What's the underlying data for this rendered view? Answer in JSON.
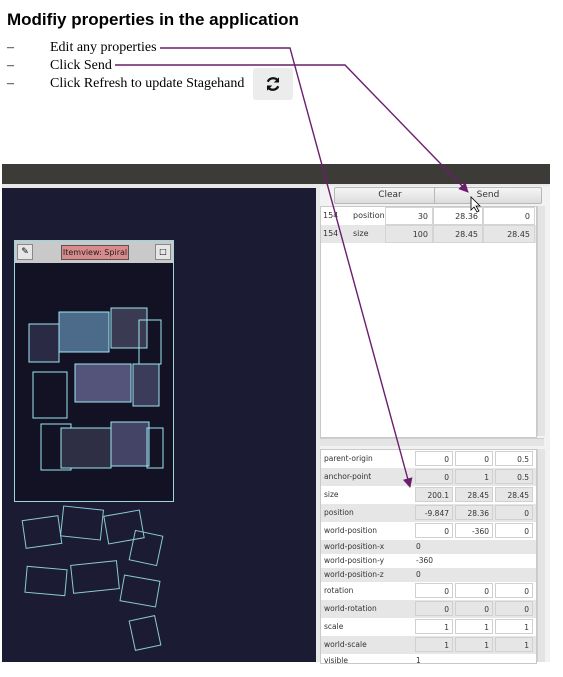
{
  "doc": {
    "title": "Modifiy properties in the application",
    "bullets": [
      {
        "dash": "–",
        "text": "Edit any properties"
      },
      {
        "dash": "–",
        "text": "Click Send"
      },
      {
        "dash": "–",
        "text": "Click Refresh to update Stagehand"
      }
    ],
    "refresh_icon": "refresh-icon"
  },
  "app": {
    "inner_window_title": "Itemview: Spiral",
    "buttons": {
      "clear": "Clear",
      "send": "Send"
    },
    "pending": [
      {
        "id": "154",
        "name": "position",
        "values": [
          "30",
          "28.36",
          "0"
        ]
      },
      {
        "id": "154",
        "name": "size",
        "values": [
          "100",
          "28.45",
          "28.45"
        ]
      }
    ],
    "properties": [
      {
        "name": "parent-origin",
        "values": [
          "0",
          "0",
          "0.5"
        ]
      },
      {
        "name": "anchor-point",
        "values": [
          "0",
          "1",
          "0.5"
        ]
      },
      {
        "name": "size",
        "values": [
          "200.1",
          "28.45",
          "28.45"
        ]
      },
      {
        "name": "position",
        "values": [
          "-9.847",
          "28.36",
          "0"
        ]
      },
      {
        "name": "world-position",
        "values": [
          "0",
          "-360",
          "0"
        ]
      },
      {
        "name": "world-position-x",
        "plain": "0"
      },
      {
        "name": "world-position-y",
        "plain": "-360"
      },
      {
        "name": "world-position-z",
        "plain": "0"
      },
      {
        "name": "rotation",
        "values": [
          "0",
          "0",
          "0"
        ]
      },
      {
        "name": "world-rotation",
        "values": [
          "0",
          "0",
          "0"
        ]
      },
      {
        "name": "scale",
        "values": [
          "1",
          "1",
          "1"
        ]
      },
      {
        "name": "world-scale",
        "values": [
          "1",
          "1",
          "1"
        ]
      },
      {
        "name": "visible",
        "plain": "1"
      }
    ],
    "colors": {
      "arrow": "#6b1e6e",
      "canvas": "#1b1b33",
      "wire": "#9fe8f0"
    }
  }
}
